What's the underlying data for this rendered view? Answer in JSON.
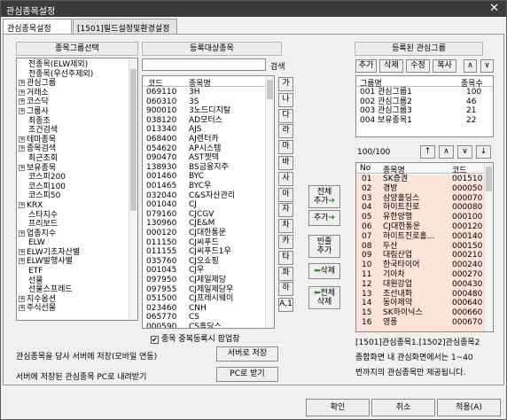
{
  "window": {
    "title": "관심종목설정",
    "close_glyph": "✕"
  },
  "tabs": [
    {
      "label": "관심종목설정"
    },
    {
      "label": "[1501]필드설정및환경설정"
    }
  ],
  "group_select": {
    "header": "종목그룹선택",
    "items": [
      {
        "label": "전종목(ELW제외)",
        "exp": false
      },
      {
        "label": "전종목(우선주제외)",
        "exp": false
      },
      {
        "label": "관심그룹",
        "exp": true
      },
      {
        "label": "거래소",
        "exp": true
      },
      {
        "label": "코스닥",
        "exp": true
      },
      {
        "label": "그룹사",
        "exp": true
      },
      {
        "label": "최종조",
        "exp": false
      },
      {
        "label": "조건검색",
        "exp": false
      },
      {
        "label": "테마종목",
        "exp": true
      },
      {
        "label": "종목검색",
        "exp": true
      },
      {
        "label": "최근조회",
        "exp": false
      },
      {
        "label": "보유종목",
        "exp": true
      },
      {
        "label": "코스피200",
        "exp": false
      },
      {
        "label": "코스피100",
        "exp": false
      },
      {
        "label": "코스피50",
        "exp": false
      },
      {
        "label": "KRX",
        "exp": true
      },
      {
        "label": "스타지수",
        "exp": false
      },
      {
        "label": "프리보드",
        "exp": false
      },
      {
        "label": "업종지수",
        "exp": true
      },
      {
        "label": "ELW",
        "exp": false
      },
      {
        "label": "ELW기초자산별",
        "exp": true
      },
      {
        "label": "ELW발행사별",
        "exp": true
      },
      {
        "label": "ETF",
        "exp": false
      },
      {
        "label": "선물",
        "exp": false
      },
      {
        "label": "선물스프레드",
        "exp": false
      },
      {
        "label": "지수옵션",
        "exp": true
      },
      {
        "label": "주식선물",
        "exp": true
      }
    ]
  },
  "register_target": {
    "header": "등록대상종목",
    "search_label": "검색",
    "search_value": "",
    "col_code": "코드",
    "col_name": "종목명",
    "rows": [
      [
        "069110",
        "3H"
      ],
      [
        "060310",
        "3S"
      ],
      [
        "900010",
        "3노드디지탈"
      ],
      [
        "038120",
        "AD모터스"
      ],
      [
        "013340",
        "AJS"
      ],
      [
        "068400",
        "AJ렌터카"
      ],
      [
        "054620",
        "AP시스템"
      ],
      [
        "090470",
        "AST젯텍"
      ],
      [
        "138930",
        "BS금융지주"
      ],
      [
        "001460",
        "BYC"
      ],
      [
        "001465",
        "BYC우"
      ],
      [
        "032040",
        "C&S자산관리"
      ],
      [
        "001040",
        "CJ"
      ],
      [
        "079160",
        "CJCGV"
      ],
      [
        "130960",
        "CJE&M"
      ],
      [
        "000120",
        "CJ대한통운"
      ],
      [
        "011150",
        "CJ씨푸드"
      ],
      [
        "011155",
        "CJ씨푸드1우"
      ],
      [
        "035760",
        "CJ오쇼핑"
      ],
      [
        "001045",
        "CJ우"
      ],
      [
        "097950",
        "CJ제일제당"
      ],
      [
        "097955",
        "CJ제일제당우"
      ],
      [
        "051500",
        "CJ프레시웨이"
      ],
      [
        "023460",
        "CNH"
      ],
      [
        "065770",
        "CS"
      ],
      [
        "000590",
        "CS홀딩스"
      ]
    ],
    "index_keys": [
      "가",
      "나",
      "다",
      "라",
      "마",
      "바",
      "사",
      "아",
      "자",
      "차",
      "카",
      "타",
      "파",
      "하",
      "A,1"
    ],
    "dup_check": {
      "checked": true,
      "label": "종목 중복등록시 팝업창"
    }
  },
  "middle_buttons": {
    "add_all_1": "전체",
    "add_all_2": "추가",
    "add": "추가",
    "add_blank_1": "빈줄",
    "add_blank_2": "추가",
    "delete": "삭제",
    "delete_all_1": "전체",
    "delete_all_2": "삭제"
  },
  "registered_groups": {
    "header": "등록된 관심그룹",
    "buttons": [
      "추가",
      "삭제",
      "수정",
      "복사"
    ],
    "up": "∧",
    "down": "∨",
    "col_group": "그룹명",
    "col_count": "종목수",
    "rows": [
      [
        "001",
        "관심그룹1",
        "100"
      ],
      [
        "002",
        "관심그룹2",
        "46"
      ],
      [
        "003",
        "관심그룹3",
        "21"
      ],
      [
        "004",
        "보유종목1",
        "22"
      ]
    ]
  },
  "group_stocks": {
    "count": "100/100",
    "arrows": [
      "↑",
      "∧",
      "∨",
      "↓"
    ],
    "col_no": "No",
    "col_name": "종목명",
    "col_code": "코드",
    "rows": [
      [
        "01",
        "SK증권",
        "001510"
      ],
      [
        "02",
        "경방",
        "000050"
      ],
      [
        "03",
        "삼양홀딩스",
        "000070"
      ],
      [
        "04",
        "하이트진로",
        "000080"
      ],
      [
        "05",
        "유한양행",
        "000100"
      ],
      [
        "06",
        "CJ대한통운",
        "000120"
      ],
      [
        "07",
        "하이트진로홀...",
        "000140"
      ],
      [
        "08",
        "두산",
        "000150"
      ],
      [
        "09",
        "대림산업",
        "000210"
      ],
      [
        "10",
        "한국타이어",
        "000240"
      ],
      [
        "11",
        "기아차",
        "000270"
      ],
      [
        "12",
        "대원강업",
        "000430"
      ],
      [
        "13",
        "조선내화",
        "000480"
      ],
      [
        "14",
        "동아제약",
        "000640"
      ],
      [
        "15",
        "SK하이닉스",
        "000660"
      ],
      [
        "16",
        "영풍",
        "000670"
      ]
    ]
  },
  "footer": {
    "save_desc": "관심종목을 당사 서버에 저장(모바일 연동)",
    "save_btn": "서버로 저장",
    "load_desc": "서버에 저장된 관심종목 PC로 내려받기",
    "load_btn": "PC로 받기",
    "note1": "[1501]관심종목1.[1502]관심종목2",
    "note2": "종합화면 내 관심화면에서는 1~40",
    "note3": "번까지의 관심종목만 제공됩니다."
  },
  "actions": {
    "ok": "확인",
    "cancel": "취소",
    "apply": "적용(A)"
  },
  "colors": {
    "titlebar": "#3b3b3b",
    "highlight_list": "#fbe5d6"
  }
}
